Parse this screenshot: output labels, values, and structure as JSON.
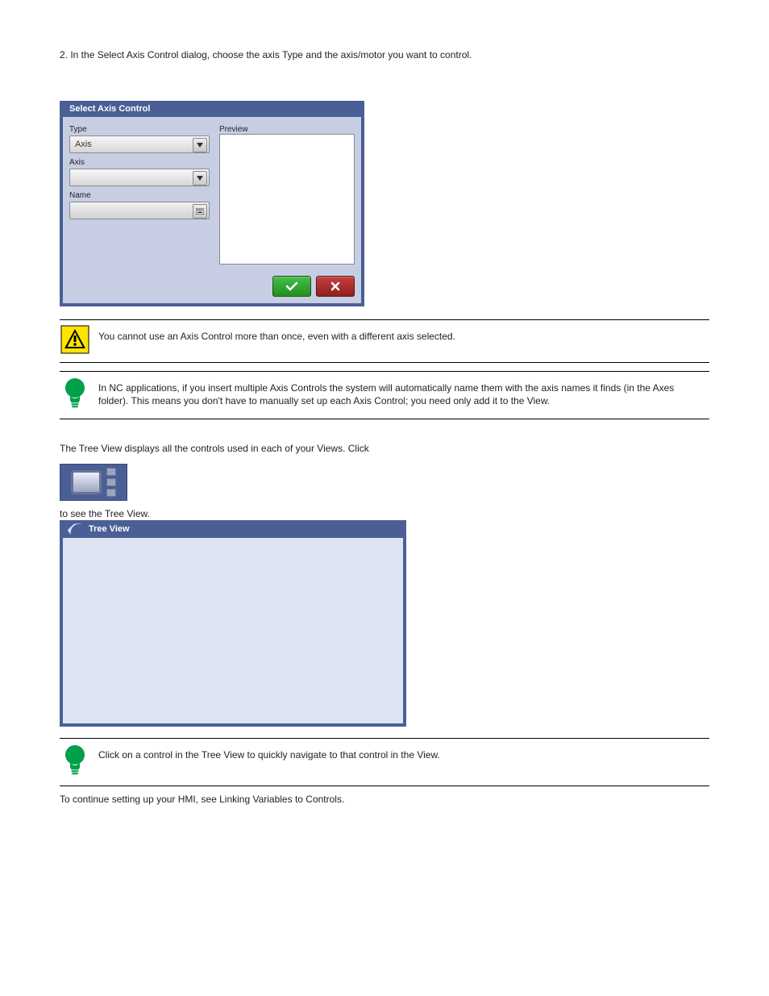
{
  "intro_line": "2. In the Select Axis Control dialog, choose the axis Type and the axis/motor you want to control.",
  "dialog1": {
    "title": "Select Axis Control",
    "type_label": "Type",
    "type_value": "Axis",
    "axis_label": "Axis",
    "axis_value": "",
    "name_label": "Name",
    "name_value": "",
    "preview_label": "Preview"
  },
  "callouts": {
    "warning_text": "You cannot use an Axis Control more than once, even with a different axis selected.",
    "tip1_text": "In NC applications, if you insert multiple Axis Controls the system will automatically name them with the axis names it finds (in the Axes folder). This means you don't have to manually set up each Axis Control; you need only add it to the View.",
    "tip2_text": "Click on a control in the Tree View to quickly navigate to that control in the View."
  },
  "treeview_section": {
    "lead_text": "The Tree View displays all the controls used in each of your Views. Click",
    "lead_text_after": "to see the Tree View.",
    "title": "Tree View"
  },
  "closing_text": "To continue setting up your HMI, see Linking Variables to Controls."
}
